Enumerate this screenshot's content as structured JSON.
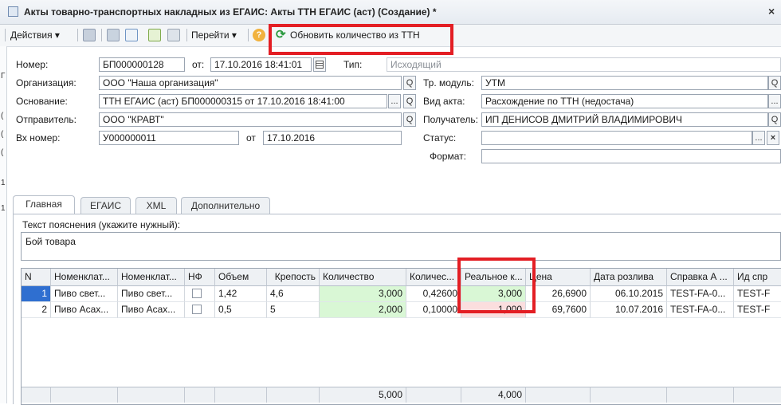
{
  "window": {
    "title": "Акты товарно-транспортных накладных из ЕГАИС: Акты ТТН ЕГАИС (аст) (Создание) *",
    "close_glyph": "×"
  },
  "toolbar": {
    "actions_label": "Действия ▾",
    "goto_label": "Перейти ▾",
    "help_glyph": "?",
    "refresh_label": "Обновить количество из ТТН",
    "refresh_glyph": "⟳"
  },
  "left_strip": [
    "Г",
    "(",
    "(",
    "(",
    "1",
    "1"
  ],
  "form": {
    "number_label": "Номер:",
    "number_value": "БП000000128",
    "from_label": "от:",
    "date_value": "17.10.2016 18:41:01",
    "type_label": "Тип:",
    "type_value": "Исходящий",
    "org_label": "Организация:",
    "org_value": "ООО \"Наша организация\"",
    "module_label": "Тр. модуль:",
    "module_value": "УТМ",
    "basis_label": "Основание:",
    "basis_value": "ТТН ЕГАИС (аст) БП000000315 от 17.10.2016 18:41:00",
    "act_label": "Вид акта:",
    "act_value": "Расхождение по ТТН (недостача)",
    "sender_label": "Отправитель:",
    "sender_value": "ООО \"КРАВТ\"",
    "recipient_label": "Получатель:",
    "recipient_value": "ИП ДЕНИСОВ ДМИТРИЙ ВЛАДИМИРОВИЧ",
    "in_number_label": "Вх номер:",
    "in_number_value": "У000000011",
    "in_from_label": "от",
    "in_date_value": "17.10.2016",
    "status_label": "Статус:",
    "status_value": "",
    "format_label": "Формат:",
    "format_value": "",
    "search_glyph": "Q",
    "ellipsis_glyph": "...",
    "clear_glyph": "×"
  },
  "tabs": [
    "Главная",
    "ЕГАИС",
    "XML",
    "Дополнительно"
  ],
  "explanation": {
    "label": "Текст пояснения (укажите нужный):",
    "value": "Бой товара"
  },
  "table": {
    "headers": [
      "N",
      "Номенклат...",
      "Номенклат...",
      "НФ",
      "Объем",
      "Крепость",
      "Количество",
      "Количес...",
      "Реальное к...",
      "Цена",
      "Дата розлива",
      "Справка А ...",
      "Ид спр"
    ],
    "rows": [
      [
        "1",
        "Пиво свет...",
        "Пиво свет...",
        "",
        "1,42",
        "4,6",
        "3,000",
        "0,42600",
        "3,000",
        "26,6900",
        "06.10.2015",
        "TEST-FA-0...",
        "TEST-F"
      ],
      [
        "2",
        "Пиво Асах...",
        "Пиво Асах...",
        "",
        "0,5",
        "5",
        "2,000",
        "0,10000",
        "1,000",
        "69,7600",
        "10.07.2016",
        "TEST-FA-0...",
        "TEST-F"
      ]
    ],
    "totals": {
      "quantity": "5,000",
      "real": "4,000"
    }
  },
  "colors": {
    "highlight": "#e31e24",
    "green_cell": "#d9f7d5",
    "pink_cell": "#fbdede",
    "selected_row_num": "#2f6fd0"
  }
}
